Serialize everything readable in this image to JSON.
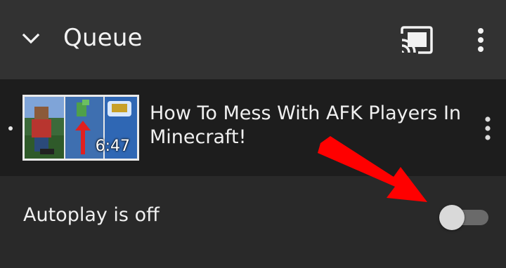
{
  "header": {
    "title": "Queue",
    "collapse_icon": "chevron-down-icon",
    "cast_icon": "cast-icon",
    "menu_icon": "more-vert-icon"
  },
  "queue_item": {
    "title": "How To Mess With AFK Players In Minecraft!",
    "duration": "6:47",
    "menu_icon": "more-vert-icon",
    "playing_indicator": "bullet-icon"
  },
  "autoplay": {
    "label": "Autoplay is off",
    "enabled": false
  },
  "colors": {
    "header_bg": "#323232",
    "item_bg": "#1d1d1d",
    "autoplay_bg": "#292929",
    "annotation_arrow": "#ff0000"
  }
}
